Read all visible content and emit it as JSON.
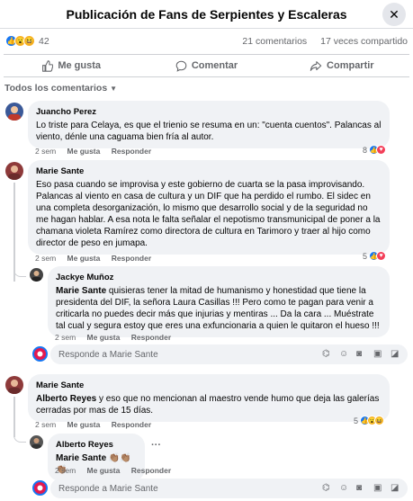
{
  "header": {
    "title": "Publicación de Fans de Serpientes y Escaleras",
    "close": "✕"
  },
  "stats": {
    "reaction_count": "42",
    "comments": "21 comentarios",
    "shares": "17 veces compartido"
  },
  "actions": {
    "like": "Me gusta",
    "comment": "Comentar",
    "share": "Compartir"
  },
  "sort_label": "Todos los comentarios",
  "comments": [
    {
      "author": "Juancho Perez",
      "text": "Lo triste para Celaya, es que el trienio se resuma en un: \"cuenta cuentos\". Palancas al viento, dénle una caguama bien fría al autor.",
      "time": "2 sem",
      "like": "Me gusta",
      "reply": "Responder",
      "reactions": "8"
    },
    {
      "author": "Marie Sante",
      "text": "Eso pasa cuando se improvisa y este gobierno de cuarta se la pasa improvisando. Palancas al viento en casa de cultura y un DIF que ha perdido el rumbo. El sidec en una completa desorganización, lo mismo que desarrollo social y de la seguridad no me hagan hablar. A esa nota le falta señalar el nepotismo transmunicipal de poner a la chamana violeta Ramírez como directora de cultura en Tarimoro y traer al hijo como director de peso en jumapa.",
      "time": "2 sem",
      "like": "Me gusta",
      "reply": "Responder",
      "reactions": "5"
    },
    {
      "author": "Jackye Muñoz",
      "mention": "Marie Sante",
      "text": " quisieras tener la mitad de humanismo y honestidad que tiene la presidenta del DIF, la señora Laura Casillas !!! Pero como te pagan para venir a criticarla no puedes decir más que injurias y mentiras ... Da la cara ... Muéstrate tal cual y segura estoy que eres una exfuncionaria a quien le quitaron el hueso !!!",
      "time": "2 sem",
      "like": "Me gusta",
      "reply": "Responder"
    },
    {
      "author": "Marie Sante",
      "mention": "Alberto Reyes",
      "text": " y eso que no mencionan al maestro vende humo que deja las galerías cerradas por mas de 15 días.",
      "time": "2 sem",
      "like": "Me gusta",
      "reply": "Responder",
      "reactions": "5"
    },
    {
      "author": "Alberto Reyes",
      "mention": "Marie Sante",
      "text": " 👏🏽👏🏽👏🏽",
      "time": "2 sem",
      "like": "Me gusta",
      "reply": "Responder"
    }
  ],
  "reply_placeholder_1": "Responde a Marie Sante",
  "reply_placeholder_2": "Responde a Marie Sante",
  "more": "···",
  "colors": {
    "accent": "#1877f2",
    "bubble": "#f0f2f5",
    "muted": "#65676b"
  }
}
